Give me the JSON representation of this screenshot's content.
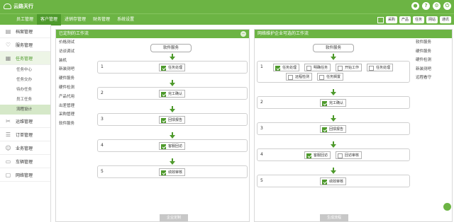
{
  "app": {
    "title": "云路天行"
  },
  "topbar": {
    "icons": [
      "user-icon",
      "help-icon",
      "settings-icon",
      "power-icon"
    ]
  },
  "nav": {
    "items": [
      "员工管理",
      "客户管理",
      "进销存管理",
      "财务管理",
      "系统设置"
    ],
    "active_index": 1,
    "right_buttons": [
      "采购",
      "产品",
      "任务",
      "网站",
      "通讯"
    ]
  },
  "sidebar": {
    "items": [
      {
        "label": "档案管理",
        "icon": "archive-icon"
      },
      {
        "label": "服务管理",
        "icon": "heart-icon"
      },
      {
        "label": "任务管理",
        "icon": "calendar-icon"
      }
    ],
    "sub_items": [
      "任务中心",
      "任务交办",
      "待办任务",
      "员工任务",
      "流程设计"
    ],
    "active_sub": 4,
    "items_after": [
      {
        "label": "运维管理",
        "icon": "tools-icon"
      },
      {
        "label": "订单管理",
        "icon": "document-icon"
      },
      {
        "label": "业务管理",
        "icon": "people-icon"
      },
      {
        "label": "车辆管理",
        "icon": "car-icon"
      },
      {
        "label": "网络管理",
        "icon": "monitor-icon"
      }
    ]
  },
  "left_panel": {
    "title": "已定制的工作流",
    "list": [
      "价格测试",
      "访谈调试",
      "装机",
      "新装测吧",
      "硬件服务",
      "硬件检测",
      "产品代用",
      "出差管理",
      "采购管理",
      "软件服务"
    ],
    "start_label": "软件服务",
    "stages": [
      {
        "num": "1",
        "tasks": [
          {
            "label": "任务处理",
            "checked": true
          }
        ]
      },
      {
        "num": "2",
        "tasks": [
          {
            "label": "完工确认",
            "checked": true
          }
        ]
      },
      {
        "num": "3",
        "tasks": [
          {
            "label": "回馈报告",
            "checked": true
          }
        ]
      },
      {
        "num": "4",
        "tasks": [
          {
            "label": "客服回访",
            "checked": true
          }
        ]
      },
      {
        "num": "5",
        "tasks": [
          {
            "label": "绩效审核",
            "checked": true
          }
        ]
      }
    ],
    "footer": "企业定制"
  },
  "right_panel": {
    "title": "网络维护企业可选的工作流",
    "start_label": "软件服务",
    "stages": [
      {
        "num": "1",
        "tasks": [
          {
            "label": "任务处理",
            "checked": true
          },
          {
            "label": "明确任务",
            "checked": false
          },
          {
            "label": "开始工作",
            "checked": false
          },
          {
            "label": "任务处理",
            "checked": false
          },
          {
            "label": "远程检测",
            "checked": false
          },
          {
            "label": "任务搁置",
            "checked": false
          }
        ]
      },
      {
        "num": "2",
        "tasks": [
          {
            "label": "完工确认",
            "checked": true
          }
        ]
      },
      {
        "num": "3",
        "tasks": [
          {
            "label": "回馈报告",
            "checked": true
          }
        ]
      },
      {
        "num": "4",
        "tasks": [
          {
            "label": "客服回访",
            "checked": true
          },
          {
            "label": "回访审核",
            "checked": false
          }
        ]
      },
      {
        "num": "5",
        "tasks": [
          {
            "label": "绩效审核",
            "checked": true
          }
        ]
      }
    ],
    "footer": "生成流程",
    "side_list": [
      "软件服务",
      "硬件服务",
      "硬件检测",
      "新装测吧",
      "远程看守"
    ]
  },
  "colors": {
    "primary": "#6cb444",
    "primary_dark": "#4e9a2c",
    "active_bg": "#d5e8c8"
  }
}
